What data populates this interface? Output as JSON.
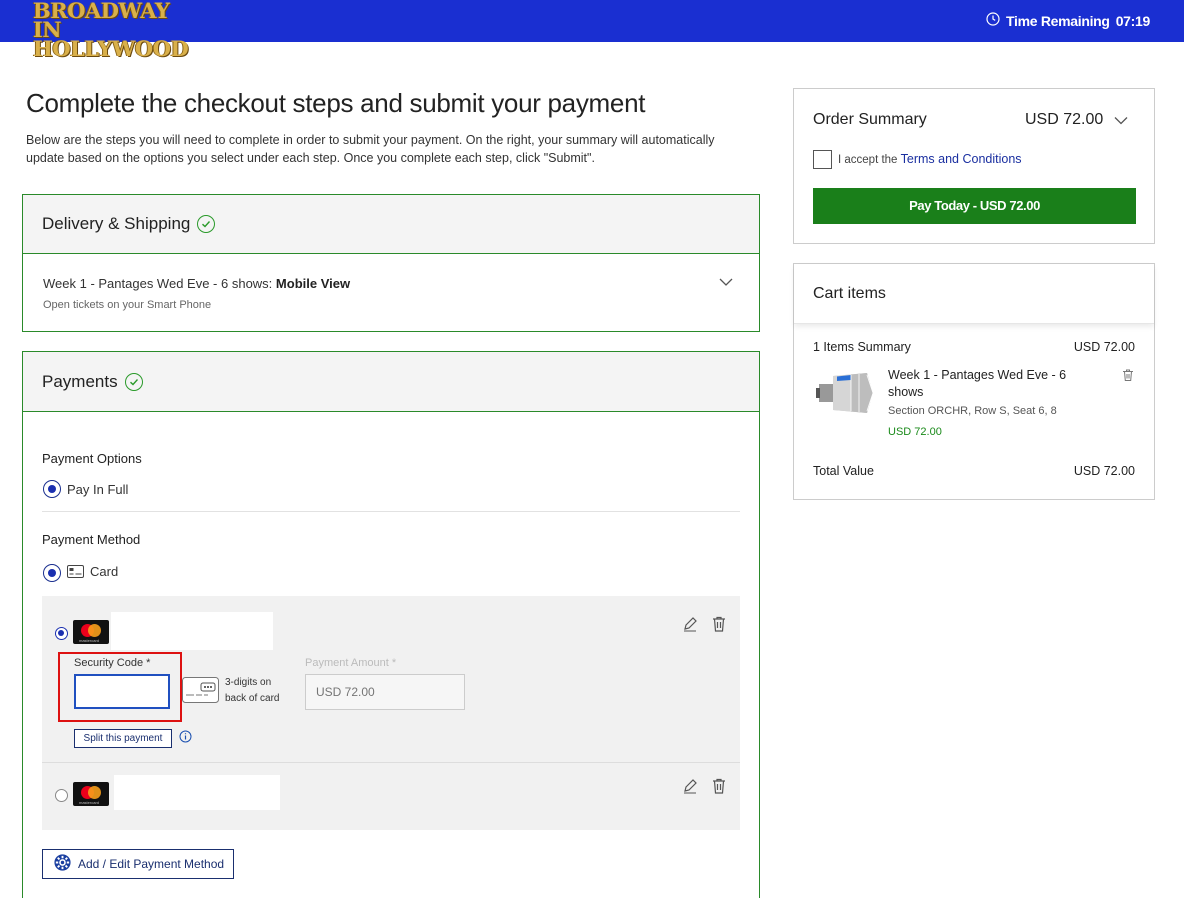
{
  "header": {
    "logo_line1": "BROADWAY IN",
    "logo_line2": "HOLLYWOOD",
    "timer_label": "Time Remaining",
    "timer_value": "07:19",
    "bar_color": "#1a2fd1"
  },
  "main": {
    "title": "Complete the checkout steps and submit your payment",
    "intro": "Below are the steps you will need to complete in order to submit your payment. On the right, your summary will automatically update based on the options you select under each step. Once you complete each step, click \"Submit\"."
  },
  "delivery": {
    "heading": "Delivery & Shipping",
    "item_prefix": "Week 1 - Pantages Wed Eve - 6 shows: ",
    "item_method": "Mobile View",
    "item_sub": "Open tickets on your Smart Phone"
  },
  "payments": {
    "heading": "Payments",
    "options_label": "Payment Options",
    "option_pay_in_full": "Pay In Full",
    "method_label": "Payment Method",
    "method_card": "Card",
    "cards": [
      {
        "brand_icon": "mastercard-logo",
        "selected": true,
        "brand_text": "mastercard"
      },
      {
        "brand_icon": "mastercard-logo",
        "selected": false,
        "brand_text": "mastercard"
      }
    ],
    "security_code_label": "Security Code *",
    "security_code_value": "",
    "cvv_hint_line1": "3-digits on",
    "cvv_hint_line2": "back of card",
    "payment_amount_label": "Payment Amount *",
    "payment_amount_placeholder": "USD 72.00",
    "split_button": "Split this payment",
    "add_edit_button": "Add / Edit Payment Method"
  },
  "order_summary": {
    "title": "Order Summary",
    "total": "USD 72.00",
    "accept_prefix": "I accept the ",
    "terms_link": "Terms and Conditions",
    "pay_button": "Pay Today - USD 72.00",
    "pay_color": "#1a7f1a"
  },
  "cart": {
    "title": "Cart items",
    "items_summary": "1 Items Summary",
    "items_summary_amount": "USD 72.00",
    "item_name": "Week 1 - Pantages Wed Eve - 6 shows",
    "item_seat": "Section ORCHR, Row S, Seat 6, 8",
    "item_price": "USD 72.00",
    "total_label": "Total Value",
    "total_value": "USD 72.00"
  }
}
